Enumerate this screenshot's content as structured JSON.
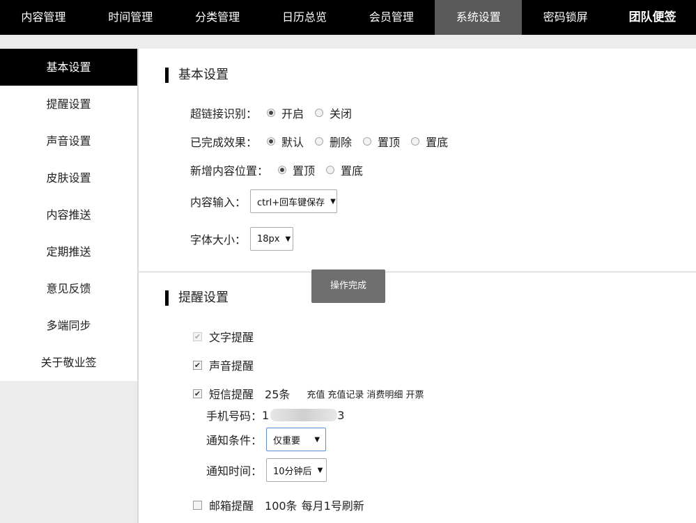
{
  "topnav": {
    "items": [
      "内容管理",
      "时间管理",
      "分类管理",
      "日历总览",
      "会员管理",
      "系统设置",
      "密码锁屏"
    ],
    "brand": "团队便签"
  },
  "sidebar": {
    "items": [
      "基本设置",
      "提醒设置",
      "声音设置",
      "皮肤设置",
      "内容推送",
      "定期推送",
      "意见反馈",
      "多端同步",
      "关于敬业签"
    ]
  },
  "basic": {
    "title": "基本设置",
    "link_label": "超链接识别：",
    "link_on": "开启",
    "link_off": "关闭",
    "done_label": "已完成效果：",
    "done_default": "默认",
    "done_delete": "删除",
    "done_top": "置顶",
    "done_bottom": "置底",
    "newpos_label": "新增内容位置：",
    "newpos_top": "置顶",
    "newpos_bottom": "置底",
    "input_label": "内容输入：",
    "input_value": "ctrl+回车键保存",
    "font_label": "字体大小：",
    "font_value": "18px"
  },
  "toast": "操作完成",
  "remind": {
    "title": "提醒设置",
    "text_remind": "文字提醒",
    "sound_remind": "声音提醒",
    "sms_remind": "短信提醒",
    "sms_count": "25条",
    "recharge": "充值",
    "recharge_record": "充值记录",
    "consume_detail": "消费明细",
    "invoice": "开票",
    "phone_label": "手机号码：",
    "phone_prefix": "1",
    "phone_suffix": "3",
    "cond_label": "通知条件：",
    "cond_value": "仅重要",
    "time_label": "通知时间：",
    "time_value": "10分钟后",
    "mail_remind": "邮箱提醒",
    "mail_count": "100条",
    "mail_refresh": "每月1号刷新"
  }
}
